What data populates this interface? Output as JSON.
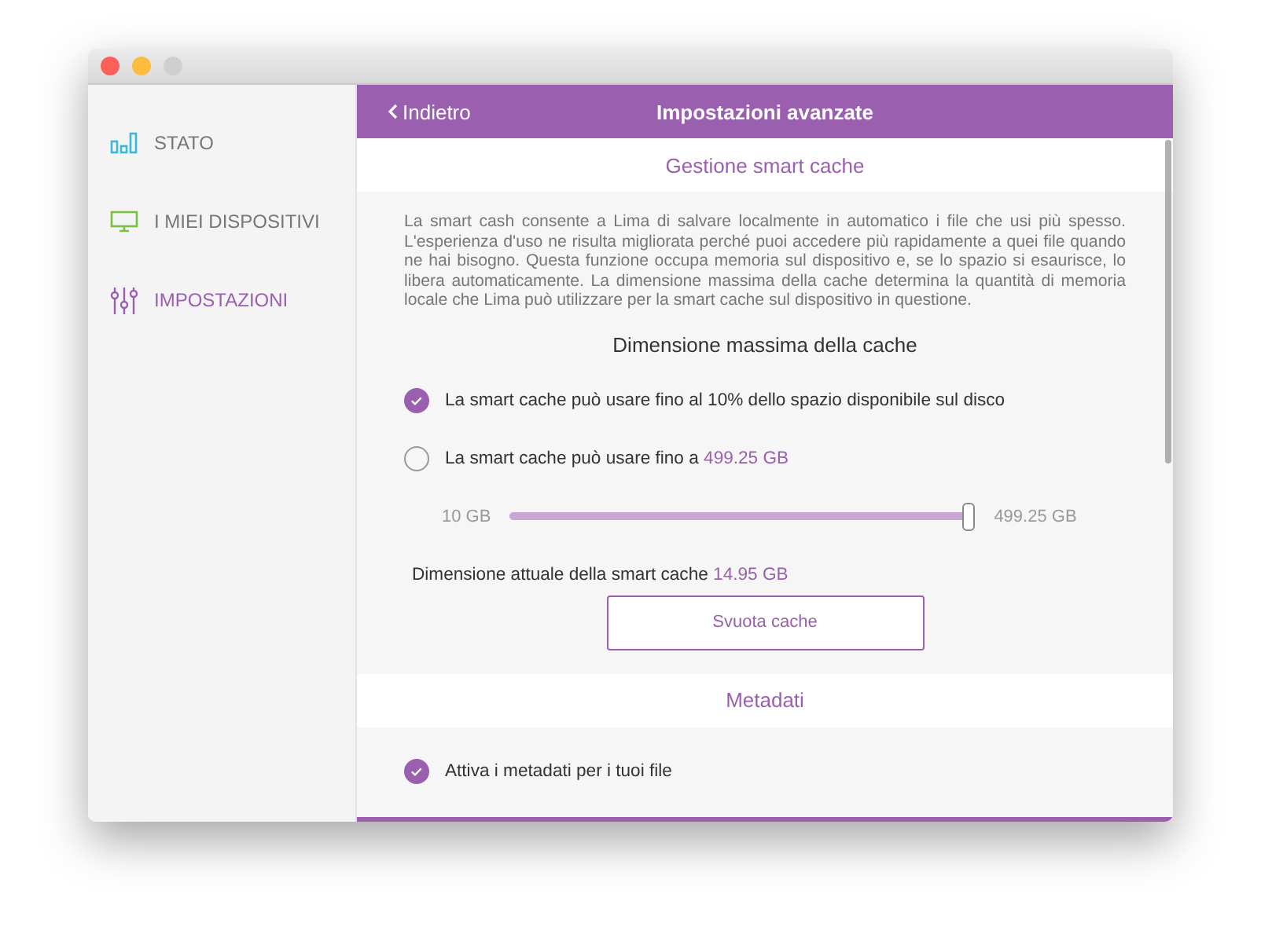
{
  "sidebar": {
    "items": [
      {
        "label": "STATO",
        "kind": "bars",
        "color": "#3bb8d8",
        "selected": false
      },
      {
        "label": "I MIEI DISPOSITIVI",
        "kind": "monitor",
        "color": "#7ac143",
        "selected": false
      },
      {
        "label": "IMPOSTAZIONI",
        "kind": "sliders",
        "color": "#9b5fb0",
        "selected": true
      }
    ]
  },
  "header": {
    "back": "Indietro",
    "title": "Impostazioni avanzate"
  },
  "sections": [
    {
      "title": "Gestione smart cache",
      "description": "La smart cash consente a Lima di salvare localmente in automatico i file che usi più spesso. L'esperienza d'uso ne risulta migliorata perché puoi accedere più rapidamente a quei file quando ne hai bisogno. Questa funzione occupa memoria sul dispositivo e, se lo spazio si esaurisce, lo libera automaticamente. La dimensione massima della cache determina la quantità di memoria locale che Lima può utilizzare per la smart cache sul dispositivo in questione.",
      "subtitle": "Dimensione massima della cache",
      "options": [
        {
          "label": "La smart cache può usare fino al 10% dello spazio disponibile sul disco",
          "selected": true
        },
        {
          "label": "La smart cache può usare fino a",
          "value": "499.25 GB",
          "selected": false
        }
      ],
      "slider": {
        "min_label": "10 GB",
        "max_label": "499.25 GB",
        "level": 1
      },
      "current": {
        "label": "Dimensione attuale della smart cache",
        "value": "14.95 GB"
      },
      "button": "Svuota cache"
    },
    {
      "title": "Metadati",
      "checkbox": {
        "label": "Attiva i metadati per i tuoi file",
        "checked": true
      }
    }
  ]
}
